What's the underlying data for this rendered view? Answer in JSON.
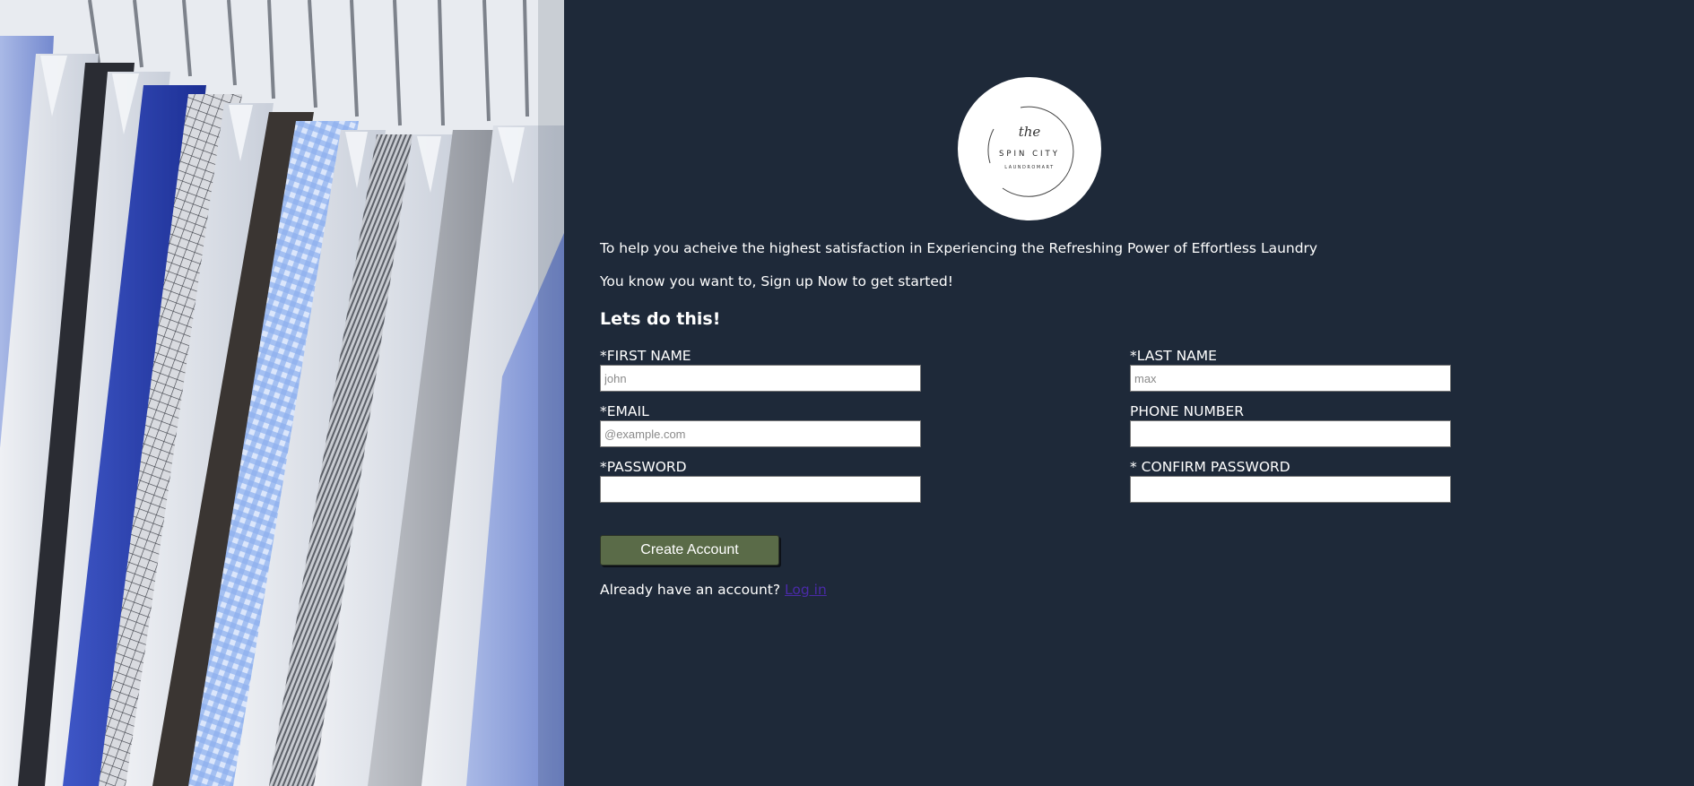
{
  "logo": {
    "script_text": "the",
    "brand_line1": "SPIN CITY",
    "brand_line2": "LAUNDROMART"
  },
  "intro": {
    "line1": "To help you acheive the highest satisfaction in Experiencing the Refreshing Power of Effortless Laundry",
    "line2": "You know you want to, Sign up Now to get started!"
  },
  "form": {
    "heading": "Lets do this!",
    "first_name": {
      "label": "*FIRST NAME",
      "placeholder": "john",
      "value": ""
    },
    "last_name": {
      "label": "*LAST NAME",
      "placeholder": "max",
      "value": ""
    },
    "email": {
      "label": "*EMAIL",
      "placeholder": "@example.com",
      "value": ""
    },
    "phone": {
      "label": "PHONE NUMBER",
      "placeholder": "",
      "value": ""
    },
    "password": {
      "label": "*PASSWORD",
      "placeholder": "",
      "value": ""
    },
    "confirm_password": {
      "label": "* CONFIRM PASSWORD",
      "placeholder": "",
      "value": ""
    },
    "submit_label": "Create Account",
    "login_prompt": "Already have an account?",
    "login_link": "Log in"
  },
  "colors": {
    "background": "#1e2939",
    "button": "#5a6b48",
    "link": "#4a2aa8"
  },
  "icons": {
    "logo": "spin-city-logo"
  }
}
